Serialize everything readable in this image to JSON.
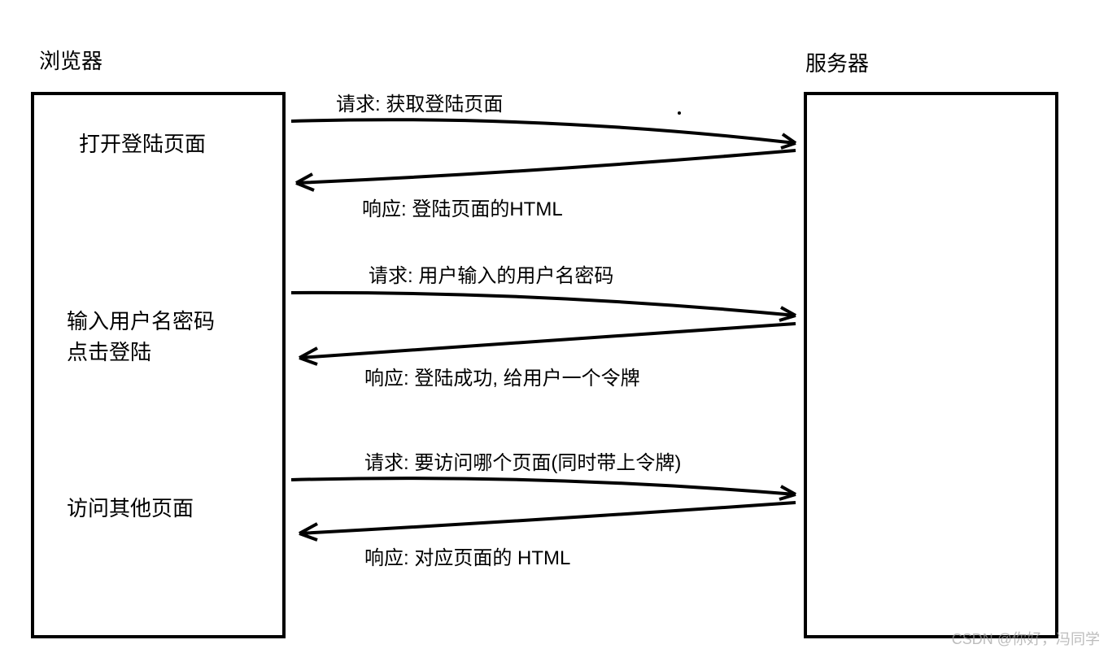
{
  "title_left": "浏览器",
  "title_right": "服务器",
  "browser_steps": {
    "step1": "打开登陆页面",
    "step2_line1": "输入用户名密码",
    "step2_line2": "点击登陆",
    "step3": "访问其他页面"
  },
  "messages": {
    "req1": "请求: 获取登陆页面",
    "res1": "响应: 登陆页面的HTML",
    "req2": "请求: 用户输入的用户名密码",
    "res2": "响应: 登陆成功, 给用户一个令牌",
    "req3": "请求: 要访问哪个页面(同时带上令牌)",
    "res3": "响应: 对应页面的 HTML"
  },
  "watermark": "CSDN @你好，冯同学"
}
